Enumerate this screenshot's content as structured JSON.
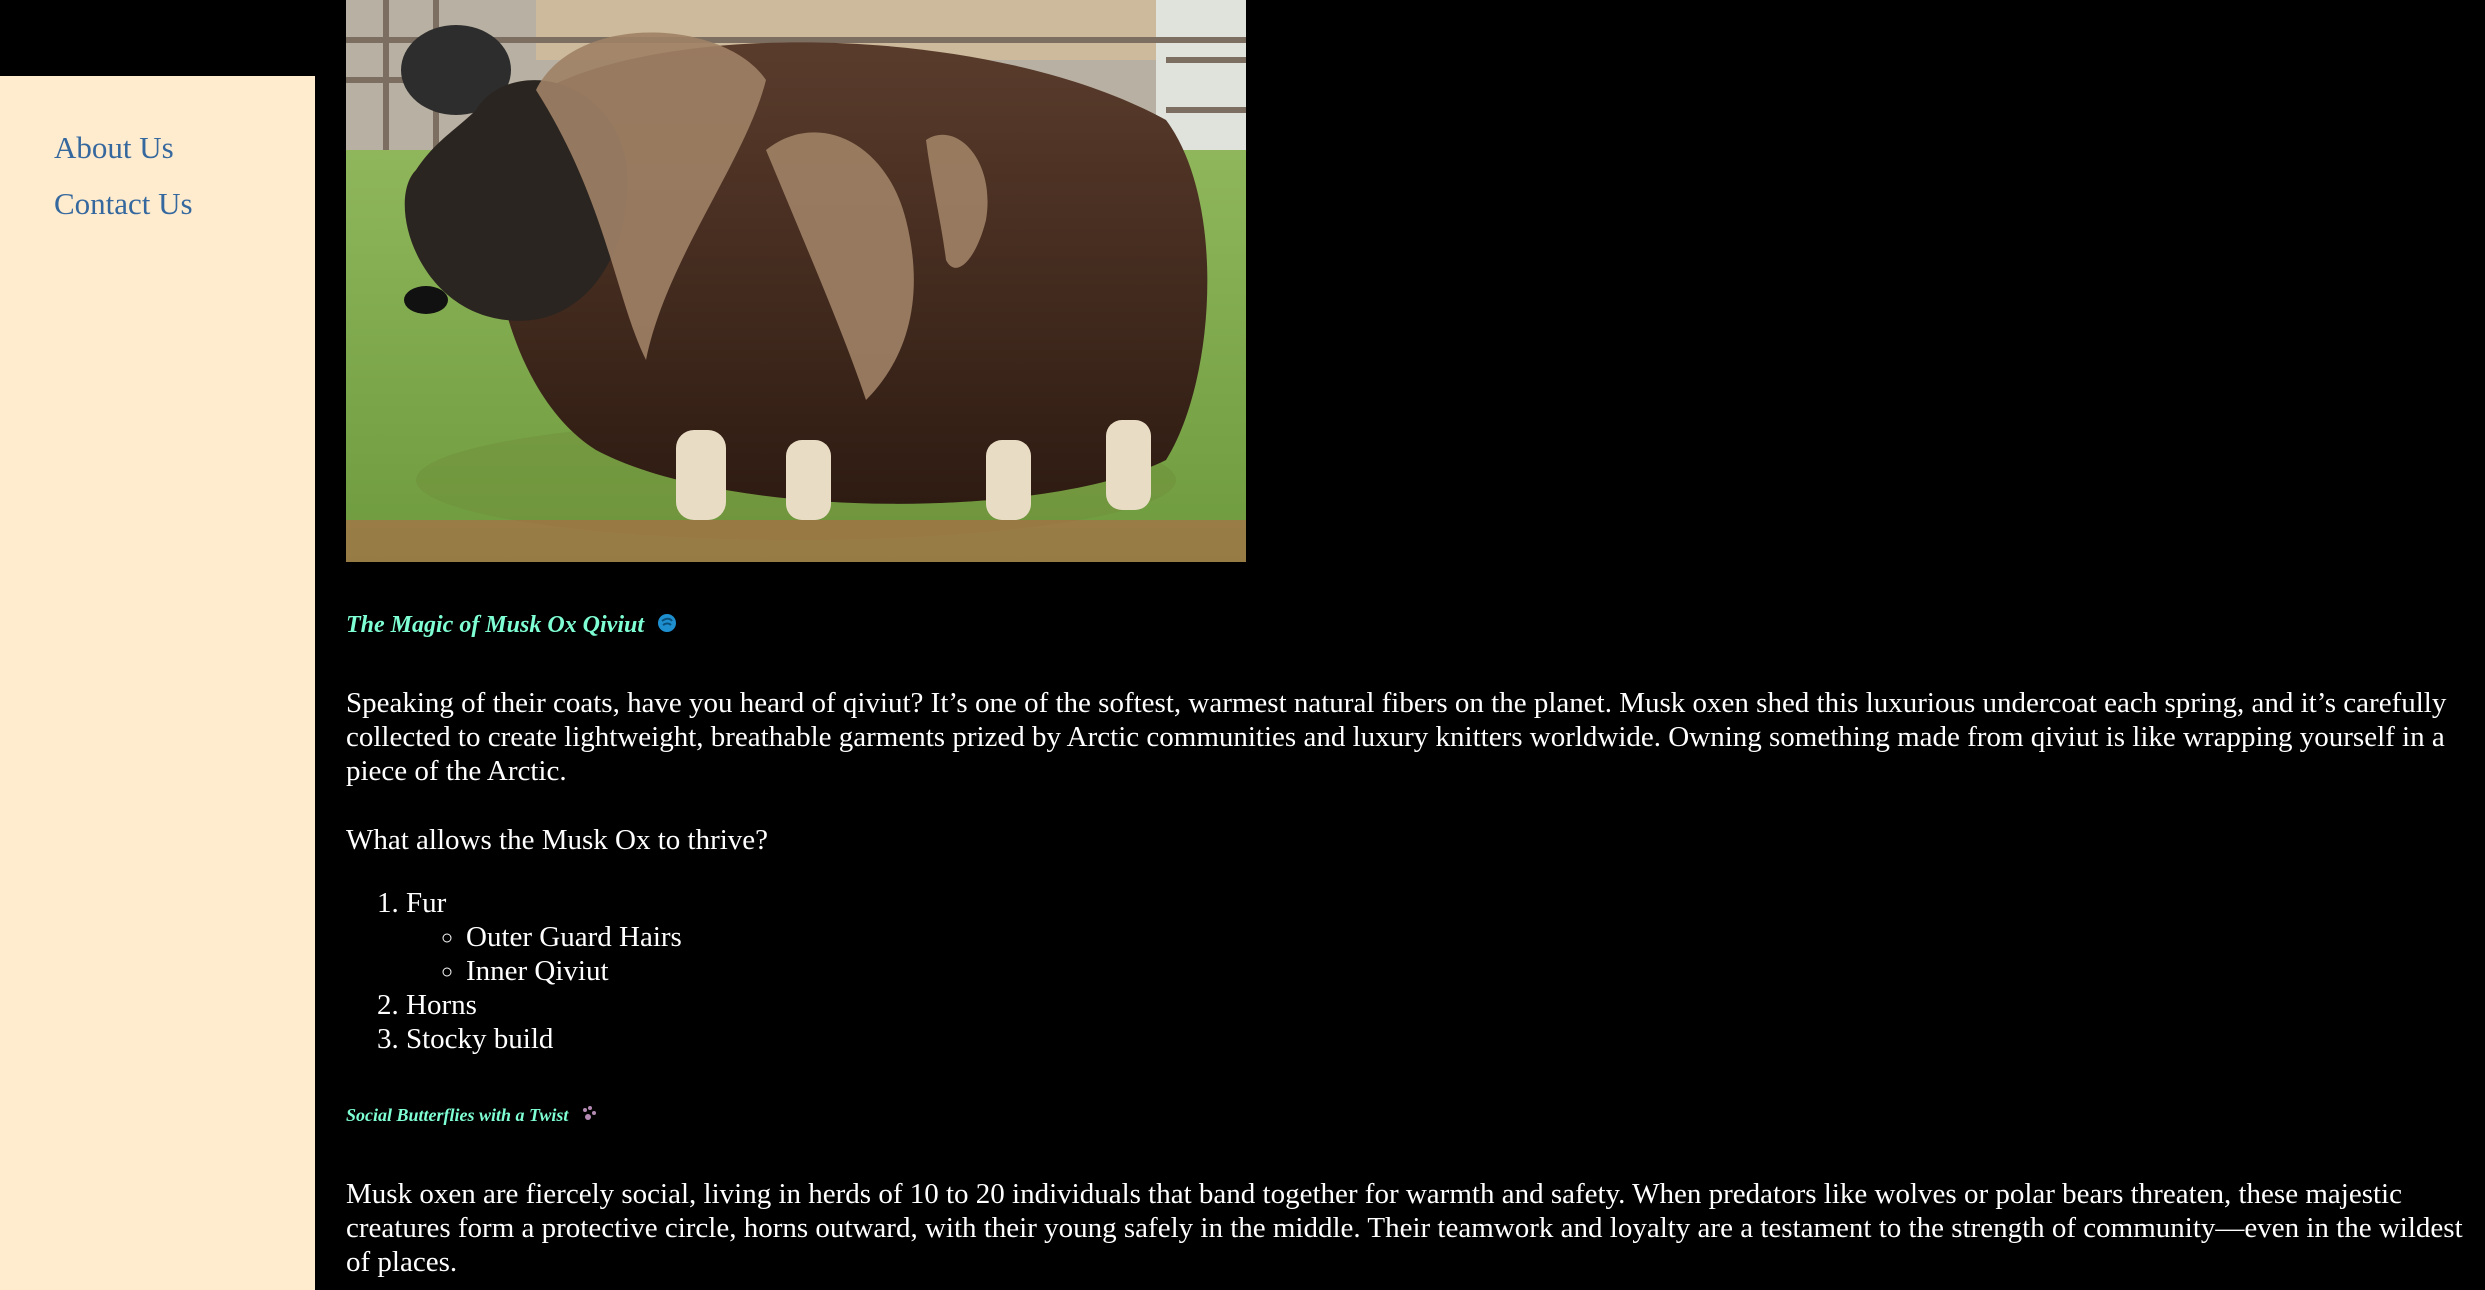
{
  "sidebar": {
    "items": [
      {
        "label": "About Us"
      },
      {
        "label": "Contact Us"
      }
    ]
  },
  "main": {
    "hero_image": {
      "subject": "musk ox photo"
    },
    "section1": {
      "heading": "The Magic of Musk Ox Qiviut",
      "heading_icon": "tornado-icon",
      "paragraph": "Speaking of their coats, have you heard of qiviut? It’s one of the softest, warmest natural fibers on the planet. Musk oxen shed this luxurious undercoat each spring, and it’s carefully collected to create lightweight, breathable garments prized by Arctic communities and luxury knitters worldwide. Owning something made from qiviut is like wrapping yourself in a piece of the Arctic.",
      "question": "What allows the Musk Ox to thrive?",
      "traits": [
        {
          "label": "Fur",
          "sub": [
            "Outer Guard Hairs",
            "Inner Qiviut"
          ]
        },
        {
          "label": "Horns"
        },
        {
          "label": "Stocky build"
        }
      ]
    },
    "section2": {
      "heading": "Social Butterflies with a Twist",
      "heading_icon": "paw-prints-icon",
      "paragraph": "Musk oxen are fiercely social, living in herds of 10 to 20 individuals that band together for warmth and safety. When predators like wolves or polar bears threaten, these majestic creatures form a protective circle, horns outward, with their young safely in the middle. Their teamwork and loyalty are a testament to the strength of community—even in the wildest of places."
    }
  },
  "colors": {
    "page_background": "#000000",
    "sidebar_background": "#ffebcd",
    "link": "#35689e",
    "heading": "#7fffd4",
    "body_text": "#ffffff"
  }
}
